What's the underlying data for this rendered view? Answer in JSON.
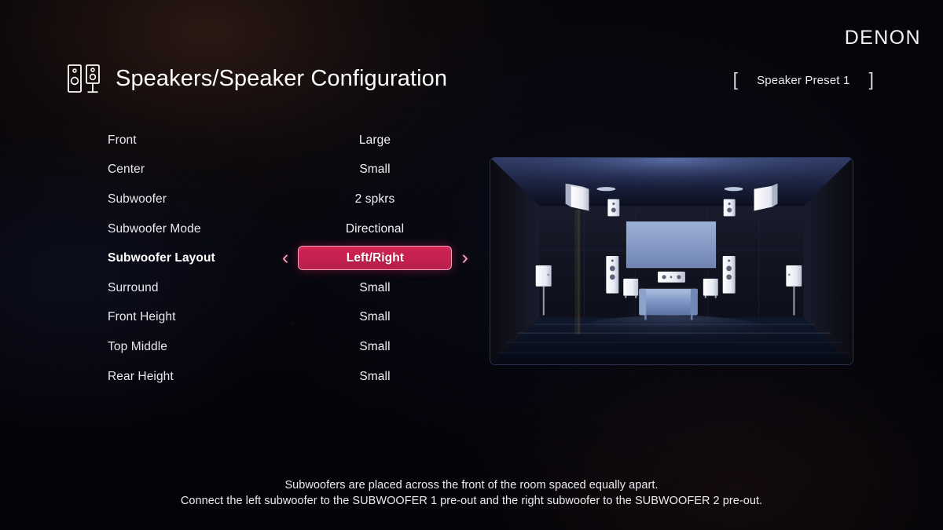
{
  "brand": "DENON",
  "header": {
    "title": "Speakers/Speaker Configuration",
    "icon": "speakers-icon",
    "preset_label": "Speaker Preset 1",
    "bracket_left": "[",
    "bracket_right": "]"
  },
  "settings": {
    "rows": [
      {
        "label": "Front",
        "value": "Large",
        "selected": false
      },
      {
        "label": "Center",
        "value": "Small",
        "selected": false
      },
      {
        "label": "Subwoofer",
        "value": "2 spkrs",
        "selected": false
      },
      {
        "label": "Subwoofer Mode",
        "value": "Directional",
        "selected": false
      },
      {
        "label": "Subwoofer Layout",
        "value": "Left/Right",
        "selected": true
      },
      {
        "label": "Surround",
        "value": "Small",
        "selected": false
      },
      {
        "label": "Front Height",
        "value": "Small",
        "selected": false
      },
      {
        "label": "Top Middle",
        "value": "Small",
        "selected": false
      },
      {
        "label": "Rear Height",
        "value": "Small",
        "selected": false
      }
    ],
    "prev_arrow": "‹",
    "next_arrow": "›"
  },
  "diagram": {
    "name": "home-theater-room-preview",
    "description": "Dark home theater room with TV, front tower speakers, center speaker, two subwoofers, height and surround speakers, and a couch"
  },
  "caption": {
    "line1": "Subwoofers are placed across the front of the room spaced equally apart.",
    "line2": "Connect the left subwoofer to the SUBWOOFER 1 pre-out and the right subwoofer to the SUBWOOFER 2 pre-out."
  },
  "colors": {
    "accent": "#c6214f",
    "accent_border": "#f0a3bb",
    "arrow": "#f4a6bd",
    "text": "#f2f2f6",
    "background": "#050407",
    "diagram_border": "#2b3150",
    "tv_screen": "#8ea4cf"
  }
}
